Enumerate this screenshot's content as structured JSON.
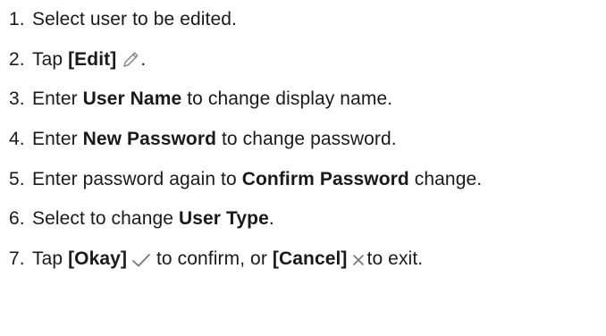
{
  "steps": [
    {
      "number": "1.",
      "parts": [
        {
          "text": "Select user to be edited."
        }
      ]
    },
    {
      "number": "2.",
      "parts": [
        {
          "text": "Tap "
        },
        {
          "text": "[Edit]",
          "bold": true
        },
        {
          "icon": "pencil-icon"
        },
        {
          "text": "."
        }
      ]
    },
    {
      "number": "3.",
      "parts": [
        {
          "text": "Enter "
        },
        {
          "text": "User Name",
          "bold": true
        },
        {
          "text": " to change display name."
        }
      ]
    },
    {
      "number": "4.",
      "parts": [
        {
          "text": "Enter "
        },
        {
          "text": "New Password",
          "bold": true
        },
        {
          "text": " to change password."
        }
      ]
    },
    {
      "number": "5.",
      "parts": [
        {
          "text": "Enter password again to "
        },
        {
          "text": "Confirm Password",
          "bold": true
        },
        {
          "text": " change."
        }
      ]
    },
    {
      "number": "6.",
      "parts": [
        {
          "text": "Select to change "
        },
        {
          "text": "User Type",
          "bold": true
        },
        {
          "text": "."
        }
      ]
    },
    {
      "number": "7.",
      "parts": [
        {
          "text": "Tap "
        },
        {
          "text": "[Okay]",
          "bold": true
        },
        {
          "icon": "checkmark-icon"
        },
        {
          "text": " to confirm, or "
        },
        {
          "text": "[Cancel]",
          "bold": true
        },
        {
          "icon": "close-icon"
        },
        {
          "text": "to exit."
        }
      ]
    }
  ],
  "colors": {
    "text": "#1a1a1a",
    "icon": "#777777"
  }
}
